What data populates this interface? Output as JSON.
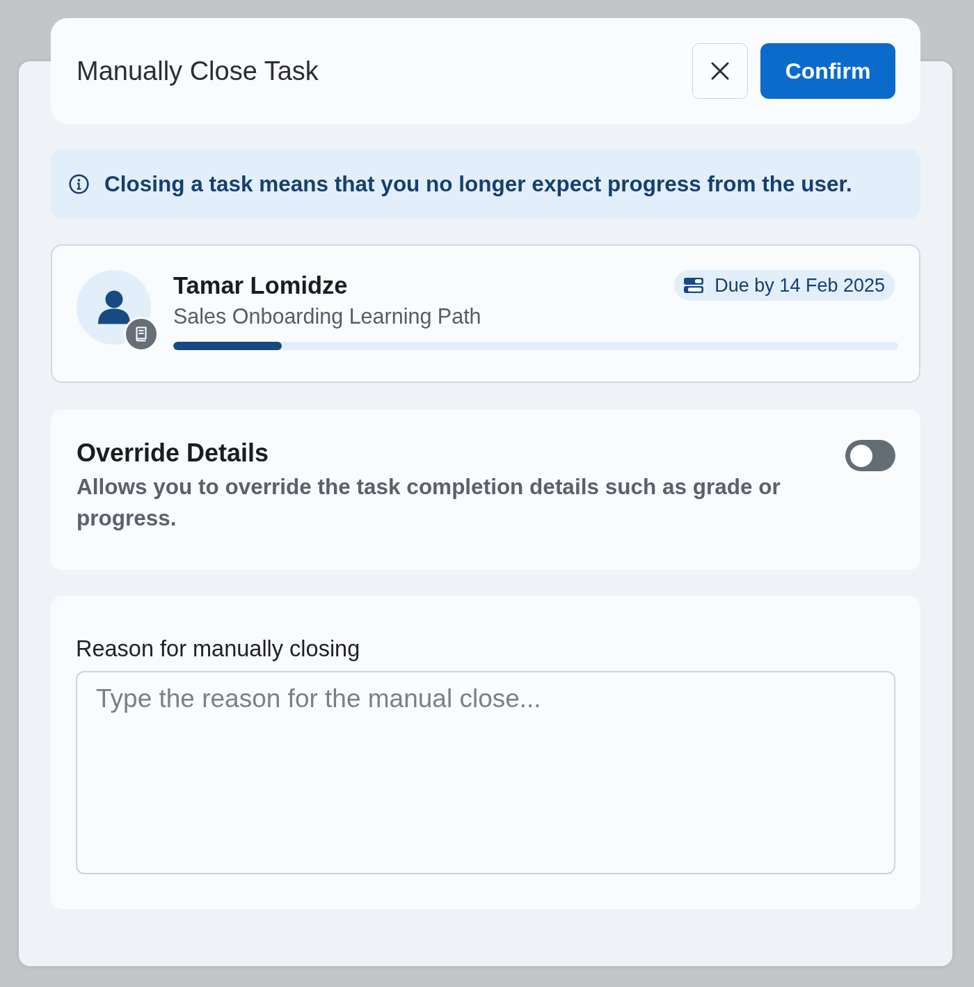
{
  "dialog": {
    "title": "Manually Close Task",
    "confirm_button": "Confirm"
  },
  "notice": {
    "text": "Closing a task means that you no longer expect progress from the user."
  },
  "task": {
    "assignee": "Tamar Lomidze",
    "learning_path": "Sales Onboarding Learning Path",
    "due_date": "Due by 14 Feb 2025",
    "progress": {
      "level": 0.15
    }
  },
  "override": {
    "title": "Override Details",
    "description": "Allows you to override the task completion details such as grade or progress.",
    "on": false
  },
  "reason": {
    "label": "Reason for manually closing",
    "placeholder": "Type the reason for the manual close..."
  }
}
